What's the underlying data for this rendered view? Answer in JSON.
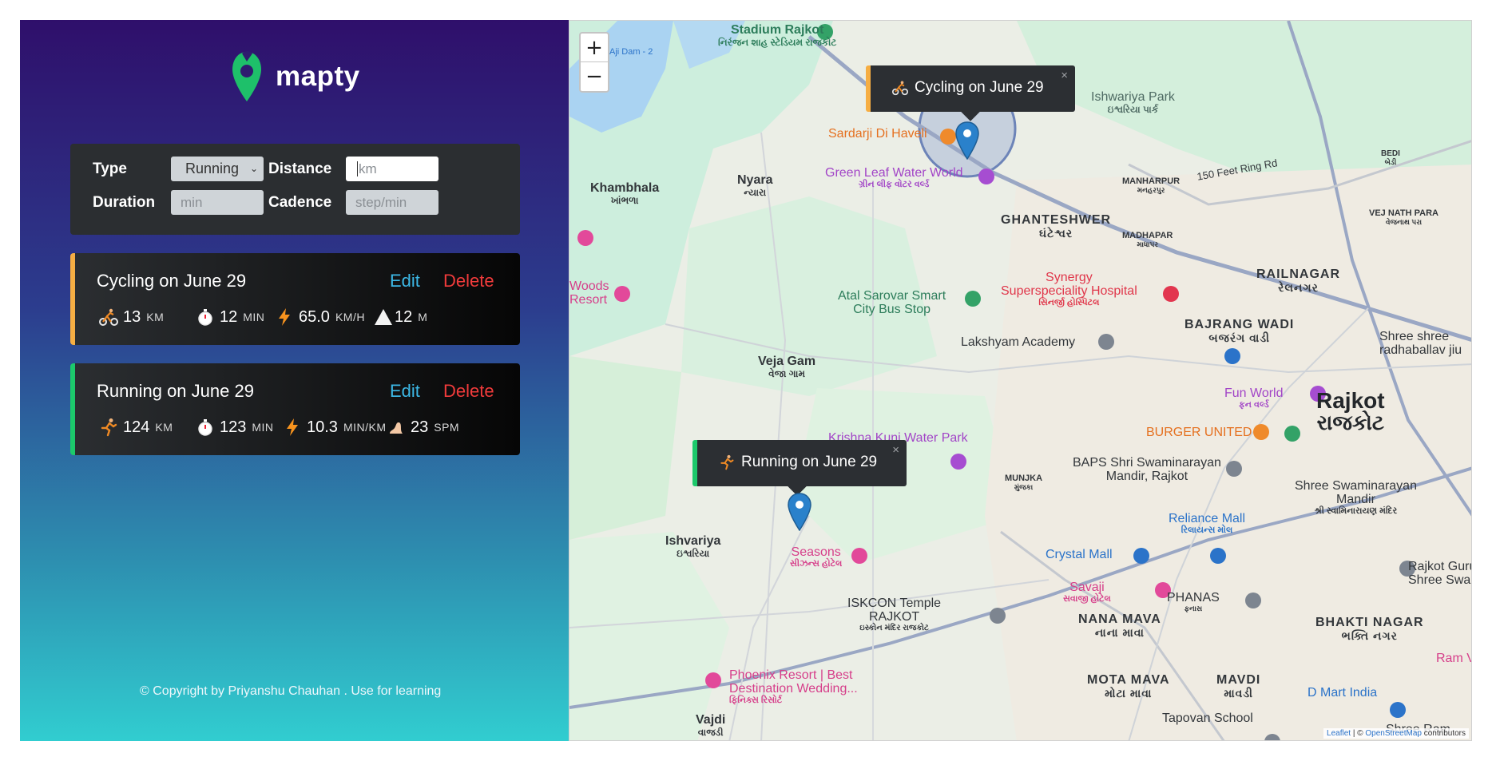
{
  "app": {
    "name": "mapty"
  },
  "form": {
    "type_label": "Type",
    "type_value": "Running",
    "distance_label": "Distance",
    "distance_placeholder": "km",
    "duration_label": "Duration",
    "duration_placeholder": "min",
    "cadence_label": "Cadence",
    "cadence_placeholder": "step/min"
  },
  "workouts": [
    {
      "title": "Cycling on June 29",
      "edit": "Edit",
      "delete": "Delete",
      "accent": "#f6ae43",
      "details": [
        {
          "icon": "cyclist-icon",
          "value": "13",
          "unit": "KM"
        },
        {
          "icon": "stopwatch-icon",
          "value": "12",
          "unit": "MIN"
        },
        {
          "icon": "lightning-icon",
          "value": "65.0",
          "unit": "KM/H"
        },
        {
          "icon": "mountain-icon",
          "value": "12",
          "unit": "M"
        }
      ]
    },
    {
      "title": "Running on June 29",
      "edit": "Edit",
      "delete": "Delete",
      "accent": "#1cc96b",
      "details": [
        {
          "icon": "runner-icon",
          "value": "124",
          "unit": "KM"
        },
        {
          "icon": "stopwatch-icon",
          "value": "123",
          "unit": "MIN"
        },
        {
          "icon": "lightning-icon",
          "value": "10.3",
          "unit": "MIN/KM"
        },
        {
          "icon": "footprint-icon",
          "value": "23",
          "unit": "SPM"
        }
      ]
    }
  ],
  "copyright": "© Copyright by Priyanshu Chauhan . Use for learning",
  "map": {
    "zoom_in": "+",
    "zoom_out": "−",
    "popups": {
      "cycling": "Cycling on June 29",
      "running": "Running on June 29",
      "close": "×"
    },
    "places": {
      "stadium": "Stadium Rajkot",
      "stadium_sub": "નિરંજન શાહ સ્ટેડિયમ રાજકોટ",
      "dam": "Aji Dam - 2",
      "ishwariya_park": "Ishwariya Park",
      "ishwariya_park_sub": "ઇશ્વરિયા પાર્ક",
      "sardarji": "Sardarji Di Haveli",
      "green_leaf": "Green Leaf Water World",
      "green_leaf_sub": "ગ્રીન લીફ વોટર વર્લ્ડ",
      "khambhala": "Khambhala",
      "khambhala_sub": "ખાંભળા",
      "nyara": "Nyara",
      "nyara_sub": "ન્યારા",
      "ghanteshwer": "GHANTESHWER",
      "ghanteshwer_sub": "ઘંટેશ્વર",
      "manharpur": "MANHARPUR",
      "manharpur_sub": "મનહરપુર",
      "ring_road": "150 Feet Ring Rd",
      "bedi": "BEDI",
      "bedi_sub": "બેડી",
      "madhapar": "MADHAPAR",
      "madhapar_sub": "માધાપર",
      "vejinathpara": "VEJ NATH PARA",
      "vejinathpara_sub": "વેજનાથ પરા",
      "woods": "Woods",
      "resort": "Resort",
      "atal": "Atal Sarovar Smart",
      "atal2": "City Bus Stop",
      "synergy": "Synergy",
      "synergy2": "Superspeciality Hospital",
      "synergy_sub": "સિનર્જી હોસ્પિટલ",
      "railnagar": "RAILNAGAR",
      "railnagar_sub": "રેલનગર",
      "lakshyam": "Lakshyam Academy",
      "bajrang": "BAJRANG WADI",
      "bajrang_sub": "બજરંગ વાડી",
      "shree_shree": "Shree shree",
      "radhaballav": "radhaballav jiu",
      "veja_gam": "Veja Gam",
      "veja_gam_sub": "વેજા ગામ",
      "fun_world": "Fun World",
      "fun_world_sub": "ફન વર્લ્ડ",
      "rajkot": "Rajkot",
      "rajkot_sub": "રાજકોટ",
      "krishna": "Krishna Kunj Water Park",
      "burger": "BURGER UNITED",
      "baps": "BAPS Shri Swaminarayan",
      "baps2": "Mandir, Rajkot",
      "munjka": "MUNJKA",
      "munjka_sub": "મુંજકા",
      "shree_swami": "Shree Swaminarayan",
      "shree_swami2": "Mandir",
      "shree_swami_sub": "શ્રી સ્વામિનારાયણ મંદિર",
      "reliance": "Reliance Mall",
      "reliance_sub": "રિલાયન્સ મોલ",
      "crystal": "Crystal Mall",
      "ishvariya": "Ishvariya",
      "ishvariya_sub": "ઇશ્વરિયા",
      "seasons": "Seasons",
      "seasons_sub": "સીઝન્સ હોટેલ",
      "savaji": "Savaji",
      "savaji_sub": "સવાજી હોટેલ",
      "rajkot_gurukul": "Rajkot Gurukul -",
      "rajkot_gurukul2": "Shree Swaminara",
      "phanas": "PHANAS",
      "phanas_sub": "ફનાસ",
      "iskcon": "ISKCON Temple",
      "iskcon2": "RAJKOT",
      "iskcon_sub": "ઇસ્કોન મંદિર રાજકોટ",
      "nana_mava": "NANA MAVA",
      "nana_mava_sub": "નાના માવા",
      "bhakti": "BHAKTI NAGAR",
      "bhakti_sub": "ભક્તિ નગર",
      "ram_van": "Ram Van",
      "phoenix": "Phoenix Resort | Best",
      "phoenix2": "Destination Wedding...",
      "phoenix_sub": "ફિનિક્સ રિસોર્ટ",
      "mota_mava": "MOTA MAVA",
      "mota_mava_sub": "મોટા માવા",
      "mavdi": "MAVDI",
      "mavdi_sub": "માવડી",
      "dmart": "D Mart India",
      "vajdi": "Vajdi",
      "vajdi_sub": "વાજડી",
      "tapovan": "Tapovan School",
      "shree_ram": "Shree Ram"
    },
    "attribution_leaflet": "Leaflet",
    "attribution_sep": " | © ",
    "attribution_osm": "OpenStreetMap",
    "attribution_tail": " contributors"
  },
  "colors": {
    "cycling": "#f6ae43",
    "running": "#1cc96b",
    "marker": "#2a81cb",
    "edit": "#3cb8e6",
    "delete": "#f03b3b"
  }
}
